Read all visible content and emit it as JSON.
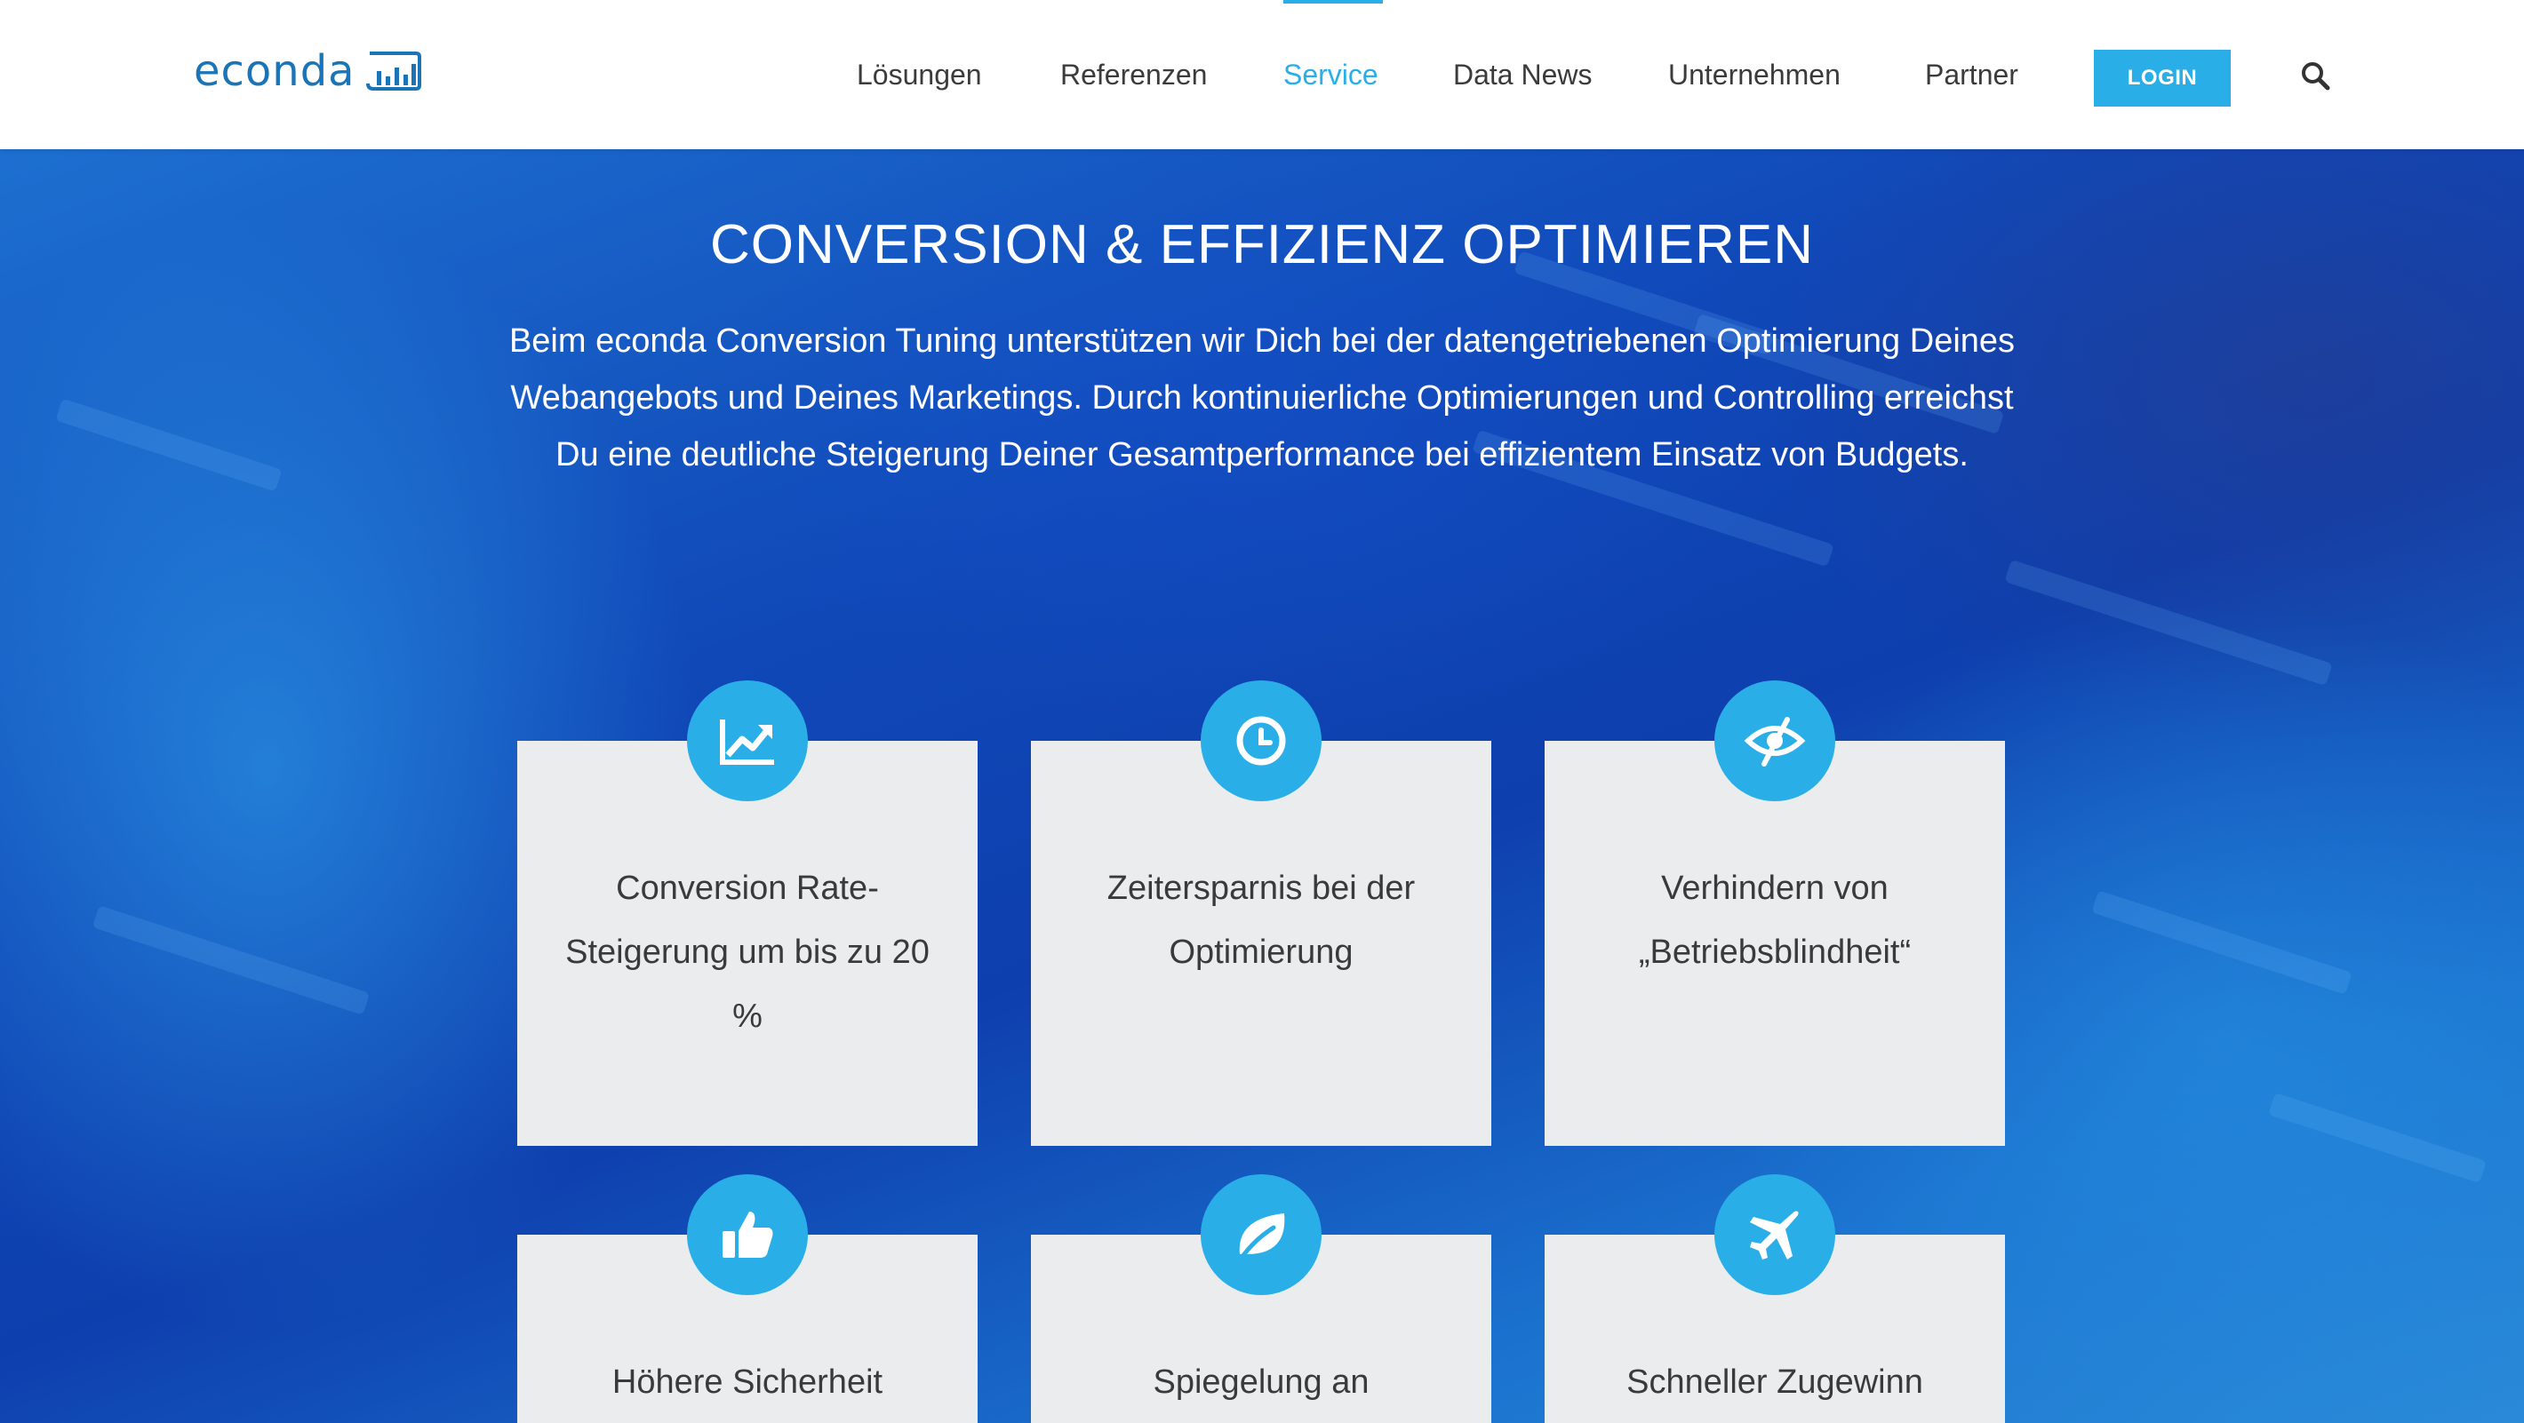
{
  "header": {
    "logo_text": "econda",
    "nav": [
      {
        "label": "Lösungen"
      },
      {
        "label": "Referenzen"
      },
      {
        "label": "Service",
        "active": true
      },
      {
        "label": "Data News"
      },
      {
        "label": "Unternehmen"
      },
      {
        "label": "Partner"
      }
    ],
    "login_label": "LOGIN",
    "accent_color": "#2aaee8",
    "brand_color": "#1b74b6"
  },
  "hero": {
    "title": "CONVERSION & EFFIZIENZ OPTIMIEREN",
    "description": "Beim econda Conversion Tuning unterstützen wir Dich bei der datengetriebenen Optimie­rung Deines Webangebots und Deines Marketings. Durch kontinuierliche Optimierungen und Controlling erreichst Du eine deutliche Steigerung Deiner Gesamtperformance bei effizientem Einsatz von Budgets."
  },
  "benefits": [
    {
      "icon": "line-chart-icon",
      "text": "Conversion Rate-Steigerung um bis zu 20 %"
    },
    {
      "icon": "clock-icon",
      "text": "Zeitersparnis bei der Optimierung"
    },
    {
      "icon": "eye-slash-icon",
      "text": "Verhindern von „Betriebsblindheit“"
    },
    {
      "icon": "thumbs-up-icon",
      "text": "Höhere Sicherheit"
    },
    {
      "icon": "leaf-icon",
      "text": "Spiegelung an"
    },
    {
      "icon": "plane-icon",
      "text": "Schneller Zugewinn"
    }
  ]
}
